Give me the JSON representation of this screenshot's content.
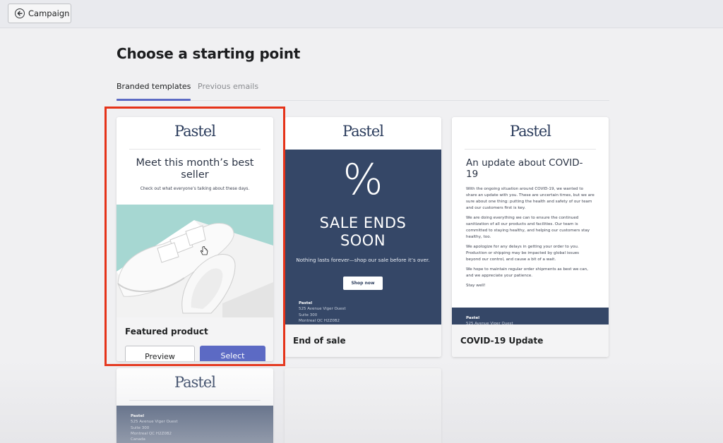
{
  "header": {
    "back_label": "Campaign"
  },
  "page": {
    "title": "Choose a starting point"
  },
  "tabs": [
    {
      "label": "Branded templates",
      "active": true
    },
    {
      "label": "Previous emails",
      "active": false
    }
  ],
  "brand": {
    "logo": "Pastel",
    "navy": "#354767",
    "accent": "#5c6ac4",
    "highlight": "#e53319"
  },
  "templates": [
    {
      "name": "Featured product",
      "headline": "Meet this month’s best seller",
      "subtext": "Check out what everyone’s talking about these days.",
      "preview_label": "Preview",
      "select_label": "Select"
    },
    {
      "name": "End of sale",
      "symbol": "%",
      "headline": "SALE ENDS SOON",
      "subtext": "Nothing lasts forever—shop our sale before it’s over.",
      "cta": "Shop now"
    },
    {
      "name": "COVID-19 Update",
      "headline": "An update about COVID-19",
      "paragraphs": [
        "With the ongoing situation around COVID-19, we wanted to share an update with you. These are uncertain times, but we are sure about one thing: putting the health and safety of our team and our customers first is key.",
        "We are doing everything we can to ensure the continued sanitization of all our products and facilities. Our team is committed to staying healthy, and helping our customers stay healthy, too.",
        "We apologize for any delays in getting your order to you. Production or shipping may be impacted by global issues beyond our control, and cause a bit of a wait.",
        "We hope to maintain regular order shipments as best we can, and we appreciate your patience.",
        "Stay well!"
      ]
    }
  ],
  "address": {
    "company": "Pastel",
    "line1": "525 Avenue Viger Ouest",
    "line2": "Suite 300",
    "line3": "Montreal QC H2Z0B2",
    "country": "Canada"
  }
}
